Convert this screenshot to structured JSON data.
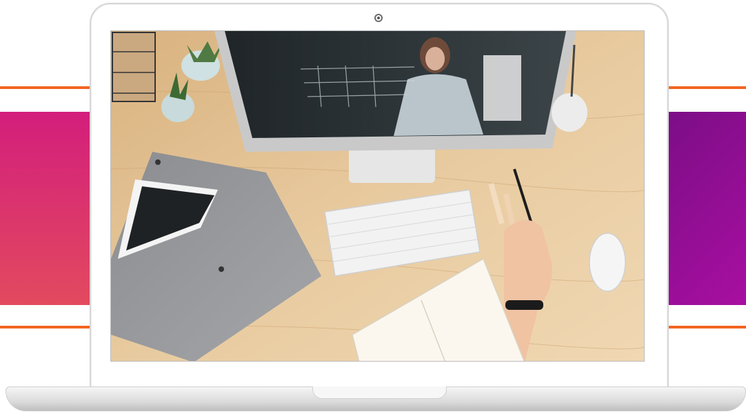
{
  "colors": {
    "accent_line": "#f26522",
    "band_left": "#d31e7c",
    "band_right": "#8a0e92",
    "laptop_frame": "#ffffff",
    "desk_wood": "#e6c79c"
  },
  "icons": {
    "camera": "camera-icon"
  },
  "photo": {
    "scene": "desk-with-monitor-video-call"
  }
}
